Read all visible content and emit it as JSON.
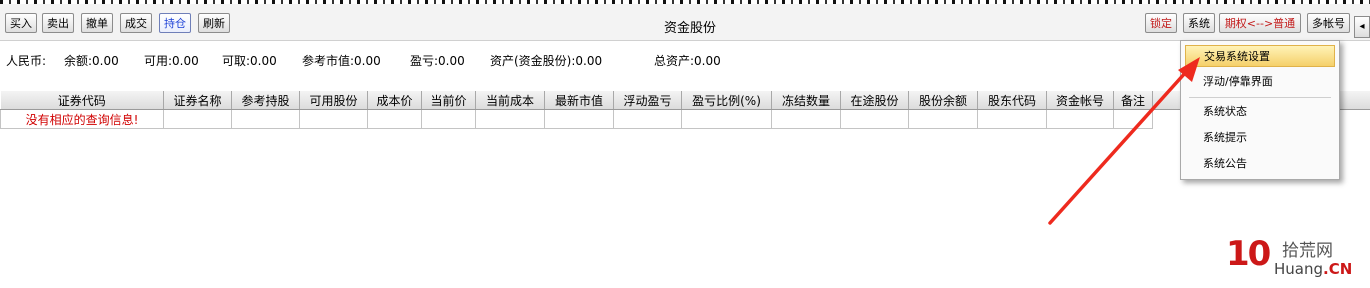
{
  "toolbar": {
    "buttons": [
      "买入",
      "卖出",
      "撤单",
      "成交",
      "持仓",
      "刷新"
    ],
    "title": "资金股份",
    "right_buttons": [
      "锁定",
      "系统",
      "期权<-->普通",
      "多帐号"
    ]
  },
  "summary": {
    "currency": "人民币:",
    "balance": "余额:0.00",
    "available": "可用:0.00",
    "withdrawable": "可取:0.00",
    "market_value": "参考市值:0.00",
    "profit_loss": "盈亏:0.00",
    "assets": "资产(资金股份):0.00",
    "total_assets": "总资产:0.00"
  },
  "table": {
    "columns": [
      "证券代码",
      "证券名称",
      "参考持股",
      "可用股份",
      "成本价",
      "当前价",
      "当前成本",
      "最新市值",
      "浮动盈亏",
      "盈亏比例(%)",
      "冻结数量",
      "在途股份",
      "股份余额",
      "股东代码",
      "资金帐号",
      "备注"
    ],
    "empty_message": "没有相应的查询信息!"
  },
  "system_menu": {
    "items": [
      "交易系统设置",
      "浮动/停靠界面",
      "系统状态",
      "系统提示",
      "系统公告"
    ]
  },
  "watermark": {
    "logo_number": "10",
    "cn": "拾荒网",
    "en_prefix": "Huang",
    "en_suffix": ".CN"
  },
  "colors": {
    "active_button_text": "#1a3fd6",
    "empty_message": "#d00000",
    "menu_highlight": "#f5d06a",
    "arrow": "#ee2a1e"
  }
}
